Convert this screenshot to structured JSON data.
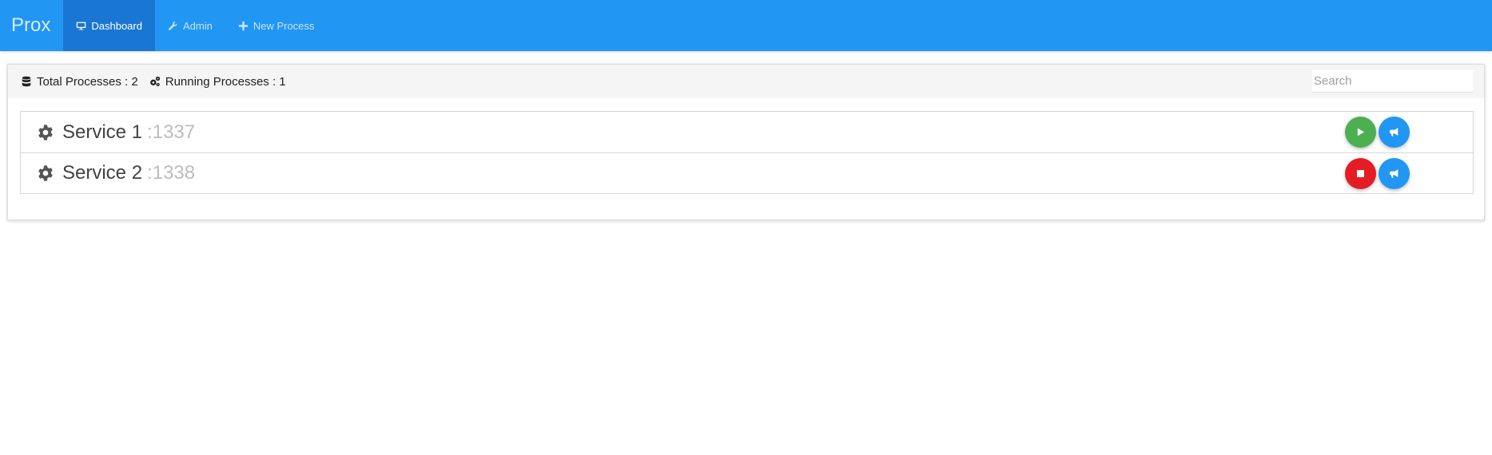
{
  "nav": {
    "brand": "Prox",
    "items": [
      {
        "label": "Dashboard",
        "icon": "monitor-icon",
        "active": true
      },
      {
        "label": "Admin",
        "icon": "wrench-icon",
        "active": false
      },
      {
        "label": "New Process",
        "icon": "plus-icon",
        "active": false
      }
    ]
  },
  "stats": {
    "total": "Total Processes : 2",
    "running": "Running Processes : 1"
  },
  "search": {
    "placeholder": "Search",
    "value": ""
  },
  "processes": [
    {
      "name": "Service 1",
      "port": ":1337",
      "state": "stopped",
      "action": "start"
    },
    {
      "name": "Service 2",
      "port": ":1338",
      "state": "running",
      "action": "stop"
    }
  ],
  "colors": {
    "navbar": "#2196f3",
    "navbar_active": "#1976d2",
    "start": "#4caf50",
    "stop": "#e51c23",
    "logs": "#2196f3"
  }
}
